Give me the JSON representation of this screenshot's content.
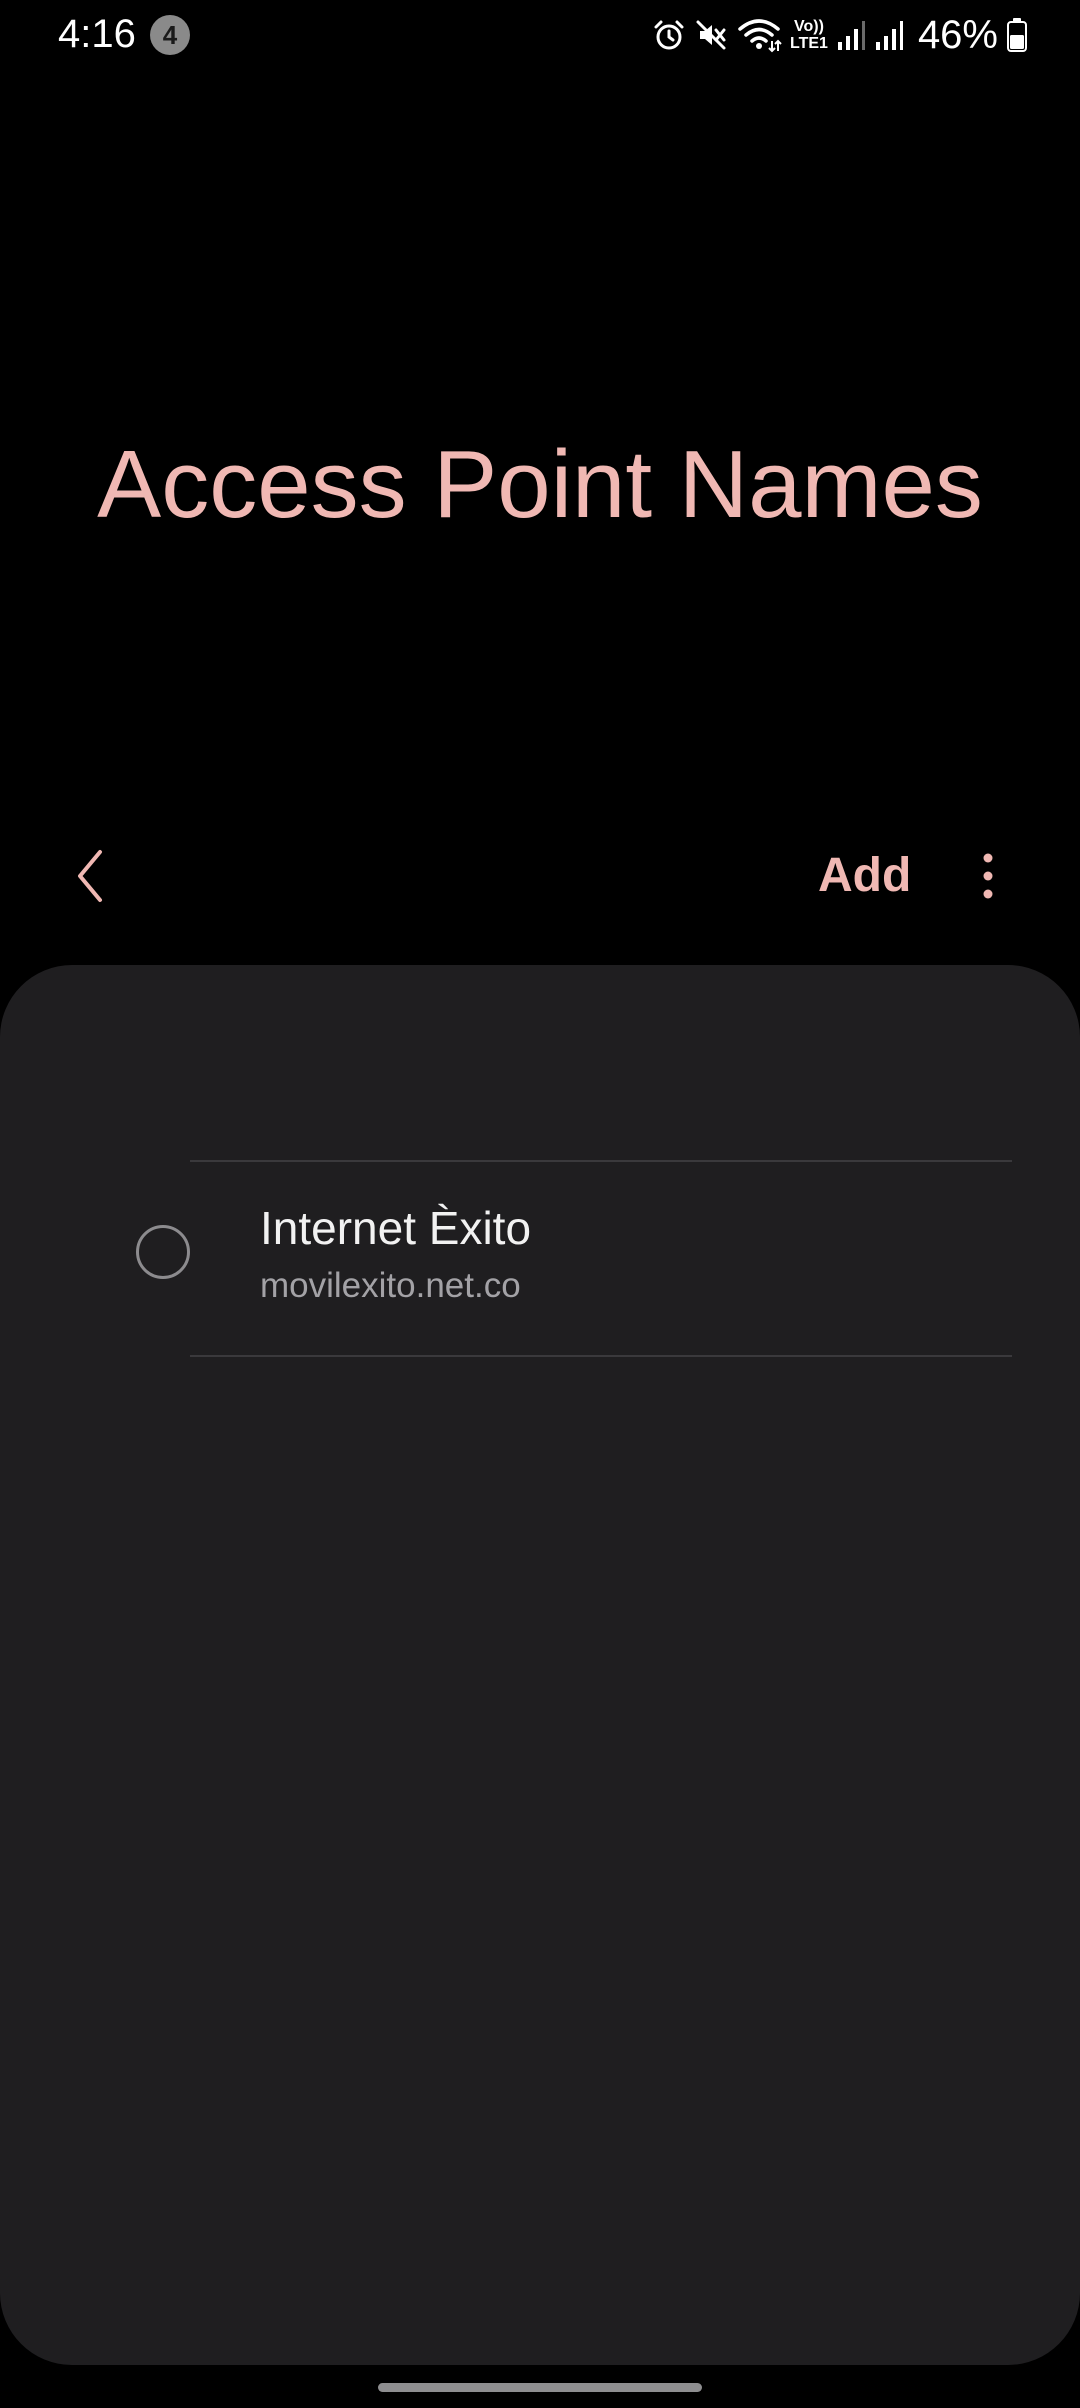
{
  "status_bar": {
    "time": "4:16",
    "notification_count": "4",
    "network_type_top": "Vo))",
    "network_type_bottom": "LTE1",
    "battery_percent": "46%",
    "icons": [
      "alarm-icon",
      "mute-icon",
      "wifi-icon",
      "volte-icon",
      "signal-icon",
      "signal-icon",
      "battery-icon"
    ]
  },
  "header": {
    "title": "Access Point Names"
  },
  "toolbar": {
    "back_icon": "chevron-left-icon",
    "add_label": "Add",
    "more_icon": "more-vertical-icon"
  },
  "apn_list": [
    {
      "name": "Internet Èxito",
      "apn": "movilexito.net.co",
      "selected": false
    }
  ],
  "colors": {
    "accent": "#f0b8b3",
    "card_background": "#1f1e20",
    "page_background": "#000000",
    "divider": "#3a393c",
    "secondary_text": "#a3a2a6"
  }
}
